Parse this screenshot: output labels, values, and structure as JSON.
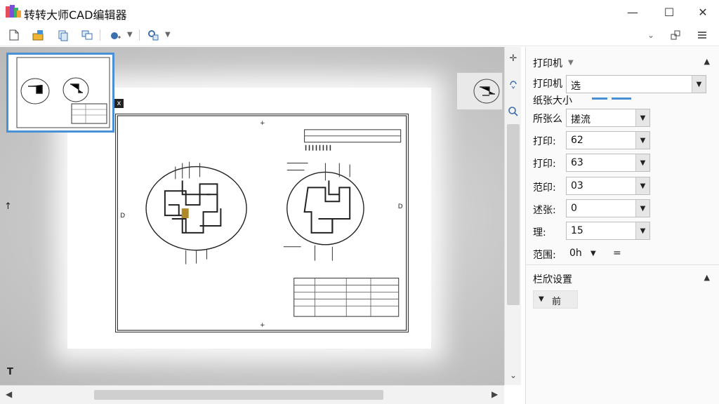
{
  "window": {
    "title": "转转大师CAD编辑器",
    "controls": {
      "minimize": "—",
      "maximize": "☐",
      "close": "✕"
    }
  },
  "toolbar": {
    "icons": [
      "new-file-icon",
      "open-file-icon",
      "copy-icon",
      "window-icon",
      "layer-icon",
      "pan-icon"
    ],
    "right_icons": [
      "chevron-down-icon",
      "tile-window-icon",
      "menu-icon"
    ]
  },
  "preview": {
    "marks": {
      "left_arrow": "↑",
      "bottom_left": "T",
      "close_thumb": "x",
      "crosshair": "✛"
    }
  },
  "panel": {
    "printer_section": {
      "title": "打印机",
      "rows": [
        {
          "label": "打印机",
          "value": "选"
        },
        {
          "label": "纸张大小",
          "value": ""
        },
        {
          "label": "所张么",
          "value": "搓流"
        },
        {
          "label": "打印:",
          "value": "62"
        },
        {
          "label": "打印:",
          "value": "63"
        },
        {
          "label": "范印:",
          "value": "03"
        },
        {
          "label": "述张:",
          "value": "0"
        },
        {
          "label": "理:",
          "value": "15"
        }
      ],
      "range_label": "范围:",
      "range_value": "0h",
      "range_equals": "="
    },
    "output_section": {
      "title": "栏欣设置",
      "button_label": "前"
    }
  },
  "colors": {
    "accent": "#4a90d6",
    "panel_bg": "#fafafa",
    "preview_bg": "#c8c8c8"
  }
}
